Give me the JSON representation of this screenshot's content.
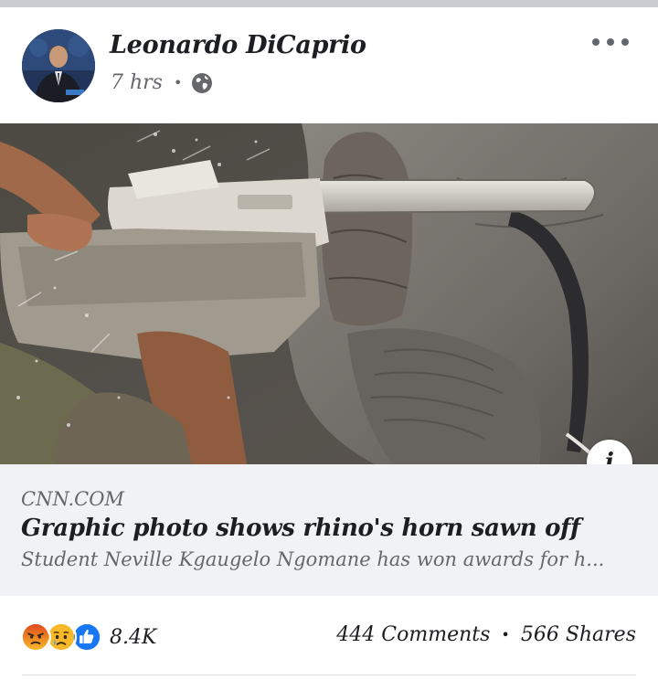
{
  "post": {
    "author": "Leonardo DiCaprio",
    "time": "7 hrs",
    "separator": "•",
    "privacy_icon": "globe-icon",
    "more_icon": "more-horizontal-icon"
  },
  "link_preview": {
    "source": "CNN.COM",
    "headline": "Graphic photo shows rhino's horn sawn off",
    "description": "Student Neville Kgaugelo Ngomane has won awards for h...",
    "info_icon": "i"
  },
  "engagement": {
    "reactions": [
      "angry",
      "sad",
      "like"
    ],
    "reaction_count": "8.4K",
    "comments": "444 Comments",
    "separator": "•",
    "shares": "566 Shares"
  },
  "colors": {
    "like_blue": "#1877f2",
    "emoji_yellow": "#f7b928",
    "angry_red": "#e9710f",
    "link_bg": "#f0f2f5",
    "secondary_text": "#65676b"
  }
}
